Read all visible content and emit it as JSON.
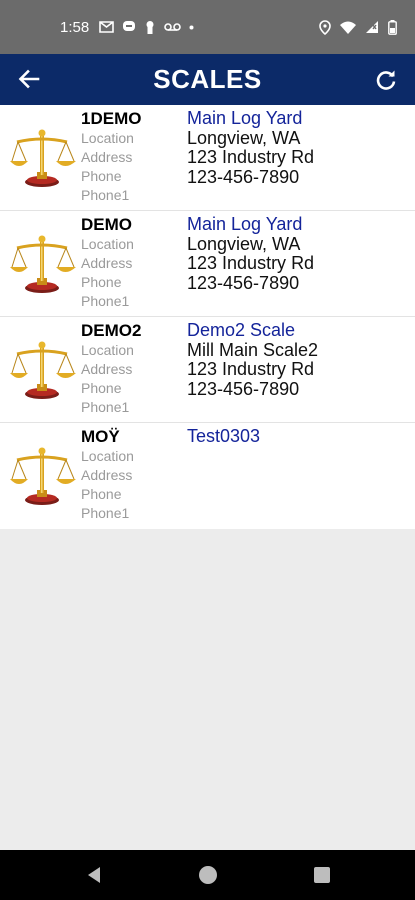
{
  "status_bar": {
    "time": "1:58",
    "icons_left": [
      "gmail-icon",
      "chat-icon",
      "keyhole-icon",
      "voicemail-icon",
      "dot-icon"
    ],
    "icons_right": [
      "location-icon",
      "wifi-icon",
      "signal-icon",
      "battery-icon"
    ]
  },
  "app_bar": {
    "title": "SCALES",
    "back_icon": "arrow-left-icon",
    "refresh_icon": "refresh-icon",
    "background": "#0c2a68"
  },
  "scales": [
    {
      "code": "1DEMO",
      "labels": [
        "Location",
        "Address",
        "Phone",
        "Phone1"
      ],
      "name": "Main Log Yard",
      "location": "Longview, WA",
      "address": "123 Industry Rd",
      "phone": "123-456-7890"
    },
    {
      "code": "DEMO",
      "labels": [
        "Location",
        "Address",
        "Phone",
        "Phone1"
      ],
      "name": "Main Log Yard",
      "location": "Longview, WA",
      "address": "123 Industry Rd",
      "phone": "123-456-7890"
    },
    {
      "code": "DEMO2",
      "labels": [
        "Location",
        "Address",
        "Phone",
        "Phone1"
      ],
      "name": "Demo2 Scale",
      "location": "Mill Main Scale2",
      "address": "123 Industry Rd",
      "phone": "123-456-7890"
    },
    {
      "code": "MOŸ",
      "labels": [
        "Location",
        "Address",
        "Phone",
        "Phone1"
      ],
      "name": "Test0303",
      "location": "",
      "address": "",
      "phone": ""
    }
  ],
  "colors": {
    "accent_name": "#14249a",
    "label_gray": "#9a9a9a",
    "background": "#ececec"
  },
  "nav_bar": {
    "icons": [
      "back-triangle-icon",
      "home-circle-icon",
      "recents-square-icon"
    ]
  }
}
